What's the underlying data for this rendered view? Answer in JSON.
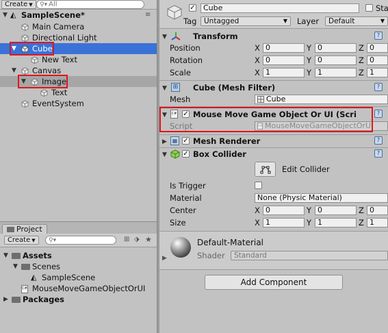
{
  "hierarchy": {
    "create_label": "Create",
    "search_placeholder": "All",
    "scene_name": "SampleScene*",
    "items": [
      {
        "label": "Main Camera"
      },
      {
        "label": "Directional Light"
      },
      {
        "label": "Cube"
      },
      {
        "label": "New Text"
      },
      {
        "label": "Canvas"
      },
      {
        "label": "Image"
      },
      {
        "label": "Text"
      },
      {
        "label": "EventSystem"
      }
    ]
  },
  "project": {
    "tab_label": "Project",
    "create_label": "Create",
    "tree": [
      {
        "label": "Assets"
      },
      {
        "label": "Scenes"
      },
      {
        "label": "SampleScene"
      },
      {
        "label": "MouseMoveGameObjectOrUI"
      },
      {
        "label": "Packages"
      }
    ]
  },
  "inspector": {
    "object_name": "Cube",
    "static_label": "Sta",
    "tag_label": "Tag",
    "tag_value": "Untagged",
    "layer_label": "Layer",
    "layer_value": "Default",
    "transform": {
      "title": "Transform",
      "rows": [
        {
          "label": "Position",
          "x": "0",
          "y": "0",
          "z": "0"
        },
        {
          "label": "Rotation",
          "x": "0",
          "y": "0",
          "z": "0"
        },
        {
          "label": "Scale",
          "x": "1",
          "y": "1",
          "z": "1"
        }
      ],
      "axis_x": "X",
      "axis_y": "Y",
      "axis_z": "Z"
    },
    "mesh_filter": {
      "title": "Cube (Mesh Filter)",
      "mesh_label": "Mesh",
      "mesh_value": "Cube"
    },
    "script_component": {
      "title": "Mouse Move Game Object Or UI (Scri",
      "script_label": "Script",
      "script_value": "MouseMoveGameObjectOrUI"
    },
    "mesh_renderer": {
      "title": "Mesh Renderer"
    },
    "box_collider": {
      "title": "Box Collider",
      "edit_label": "Edit Collider",
      "is_trigger_label": "Is Trigger",
      "material_label": "Material",
      "material_value": "None (Physic Material)",
      "center_label": "Center",
      "center": {
        "x": "0",
        "y": "0",
        "z": "0"
      },
      "size_label": "Size",
      "size": {
        "x": "1",
        "y": "1",
        "z": "1"
      }
    },
    "material": {
      "name": "Default-Material",
      "shader_label": "Shader",
      "shader_value": "Standard"
    },
    "add_component_label": "Add Component"
  },
  "colors": {
    "selection_blue": "#3a72d8",
    "highlight_red": "#e0151d",
    "panel_gray": "#c2c2c2"
  }
}
